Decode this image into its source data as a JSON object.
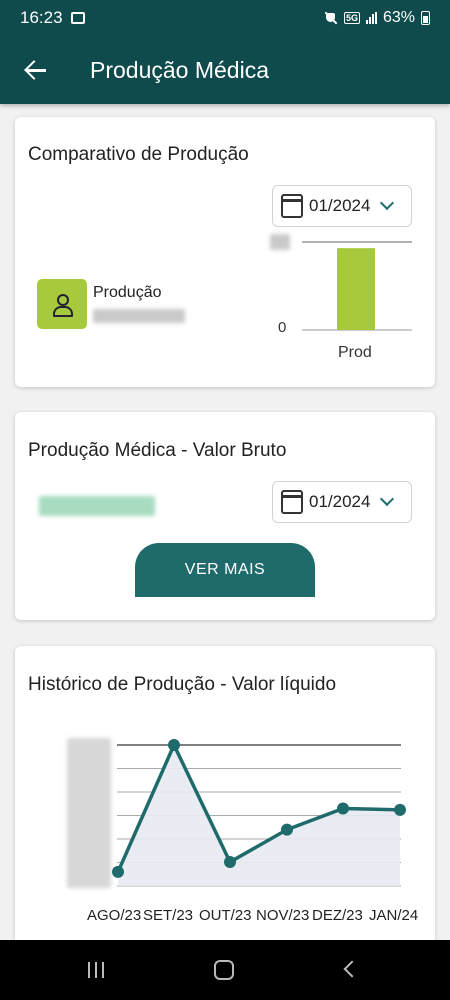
{
  "status_bar": {
    "time": "16:23",
    "battery": "63%",
    "network": "5G"
  },
  "app_bar": {
    "title": "Produção Médica"
  },
  "comparativo": {
    "title": "Comparativo de Produção",
    "month": "01/2024",
    "label": "Produção",
    "chart_data": {
      "type": "bar",
      "categories": [
        "Prod"
      ],
      "values": [
        1
      ],
      "ylim": [
        0,
        1
      ],
      "tick_labels": [
        "0"
      ],
      "color": "#a7c93e"
    }
  },
  "valor_bruto": {
    "title": "Produção Médica - Valor Bruto",
    "month": "01/2024",
    "button_label": "VER MAIS"
  },
  "historico": {
    "title": "Histórico de Produção - Valor líquido",
    "chart_data": {
      "type": "line",
      "x": [
        "AGO/23",
        "SET/23",
        "OUT/23",
        "NOV/23",
        "DEZ/23",
        "JAN/24"
      ],
      "values": [
        0.1,
        1.0,
        0.17,
        0.4,
        0.55,
        0.54
      ],
      "ylim": [
        0,
        1.0
      ],
      "color": "#1f6a6b"
    }
  }
}
